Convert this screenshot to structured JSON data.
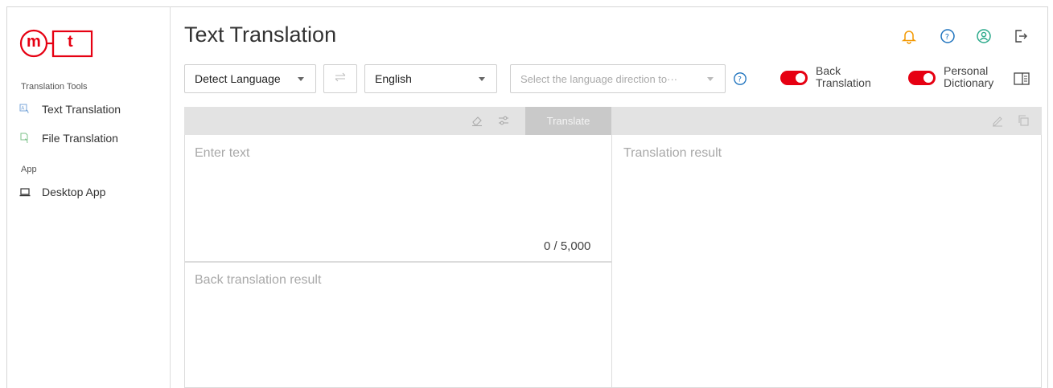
{
  "logo": {
    "left": "m",
    "right": "t"
  },
  "sidebar": {
    "section_tools": "Translation Tools",
    "items": [
      {
        "label": "Text Translation",
        "icon": "text-translate-icon"
      },
      {
        "label": "File Translation",
        "icon": "file-translate-icon"
      }
    ],
    "section_app": "App",
    "app_items": [
      {
        "label": "Desktop App",
        "icon": "laptop-icon"
      }
    ]
  },
  "header": {
    "title": "Text Translation",
    "icons": [
      "bell-icon",
      "help-icon",
      "account-icon",
      "logout-icon"
    ]
  },
  "toolbar": {
    "source_language": "Detect Language",
    "target_language": "English",
    "direction_placeholder": "Select the language direction to···",
    "back_translation_label_1": "Back",
    "back_translation_label_2": "Translation",
    "back_translation_on": true,
    "personal_dictionary_label_1": "Personal",
    "personal_dictionary_label_2": "Dictionary",
    "personal_dictionary_on": true
  },
  "input_panel": {
    "translate_label": "Translate",
    "placeholder": "Enter text",
    "counter": "0 / 5,000",
    "back_translation_placeholder": "Back translation result"
  },
  "output_panel": {
    "placeholder": "Translation result"
  },
  "colors": {
    "accent": "#e60012",
    "bell": "#f39800",
    "help": "#1e73be",
    "account": "#2aa98a"
  }
}
